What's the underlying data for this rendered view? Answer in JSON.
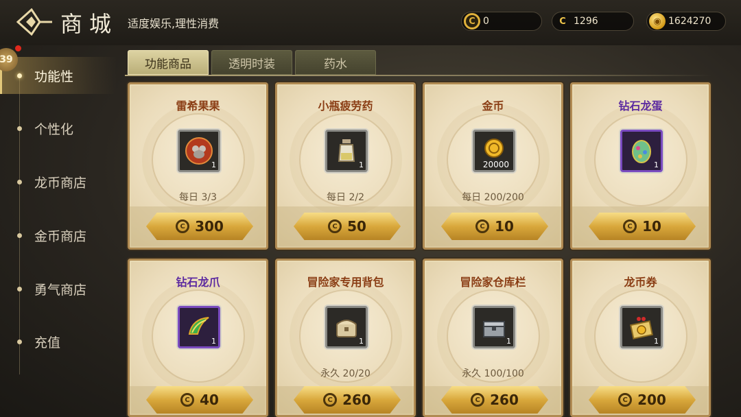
{
  "header": {
    "title": "商城",
    "subtitle": "适度娱乐,理性消费",
    "currencies": [
      {
        "icon": "gold-ring-c-icon",
        "value": "0"
      },
      {
        "icon": "dragon-coin-c-icon",
        "value": "1296"
      },
      {
        "icon": "gold-coin-icon",
        "value": "1624270"
      }
    ]
  },
  "sidebar": {
    "level_badge": "39",
    "items": [
      {
        "label": "功能性",
        "active": true
      },
      {
        "label": "个性化",
        "active": false
      },
      {
        "label": "龙币商店",
        "active": false
      },
      {
        "label": "金币商店",
        "active": false
      },
      {
        "label": "勇气商店",
        "active": false
      },
      {
        "label": "充值",
        "active": false
      }
    ]
  },
  "tabs": [
    {
      "label": "功能商品",
      "active": true
    },
    {
      "label": "透明时装",
      "active": false
    },
    {
      "label": "药水",
      "active": false
    }
  ],
  "products": [
    {
      "name": "雷希果果",
      "rarity": "normal",
      "icon": "pet-fruit-icon",
      "qty": "1",
      "limit": "每日 3/3",
      "price": "300"
    },
    {
      "name": "小瓶疲劳药",
      "rarity": "normal",
      "icon": "potion-bottle-icon",
      "qty": "1",
      "limit": "每日 2/2",
      "price": "50"
    },
    {
      "name": "金币",
      "rarity": "normal",
      "icon": "gold-coin-icon",
      "qty": "20000",
      "limit": "每日 200/200",
      "price": "10"
    },
    {
      "name": "钻石龙蛋",
      "rarity": "epic",
      "icon": "dragon-egg-icon",
      "qty": "1",
      "limit": "",
      "price": "10"
    },
    {
      "name": "钻石龙爪",
      "rarity": "epic",
      "icon": "dragon-claw-icon",
      "qty": "1",
      "limit": "",
      "price": "40"
    },
    {
      "name": "冒险家专用背包",
      "rarity": "normal",
      "icon": "backpack-chest-icon",
      "qty": "1",
      "limit": "永久 20/20",
      "price": "260"
    },
    {
      "name": "冒险家仓库栏",
      "rarity": "normal",
      "icon": "storage-chest-icon",
      "qty": "1",
      "limit": "永久 100/100",
      "price": "260"
    },
    {
      "name": "龙币券",
      "rarity": "normal",
      "icon": "dragon-coin-ticket-icon",
      "qty": "1",
      "limit": "",
      "price": "200"
    }
  ],
  "colors": {
    "accent_gold": "#e0b13b",
    "epic_purple": "#5c2aa0",
    "normal_name": "#8a3d14"
  }
}
